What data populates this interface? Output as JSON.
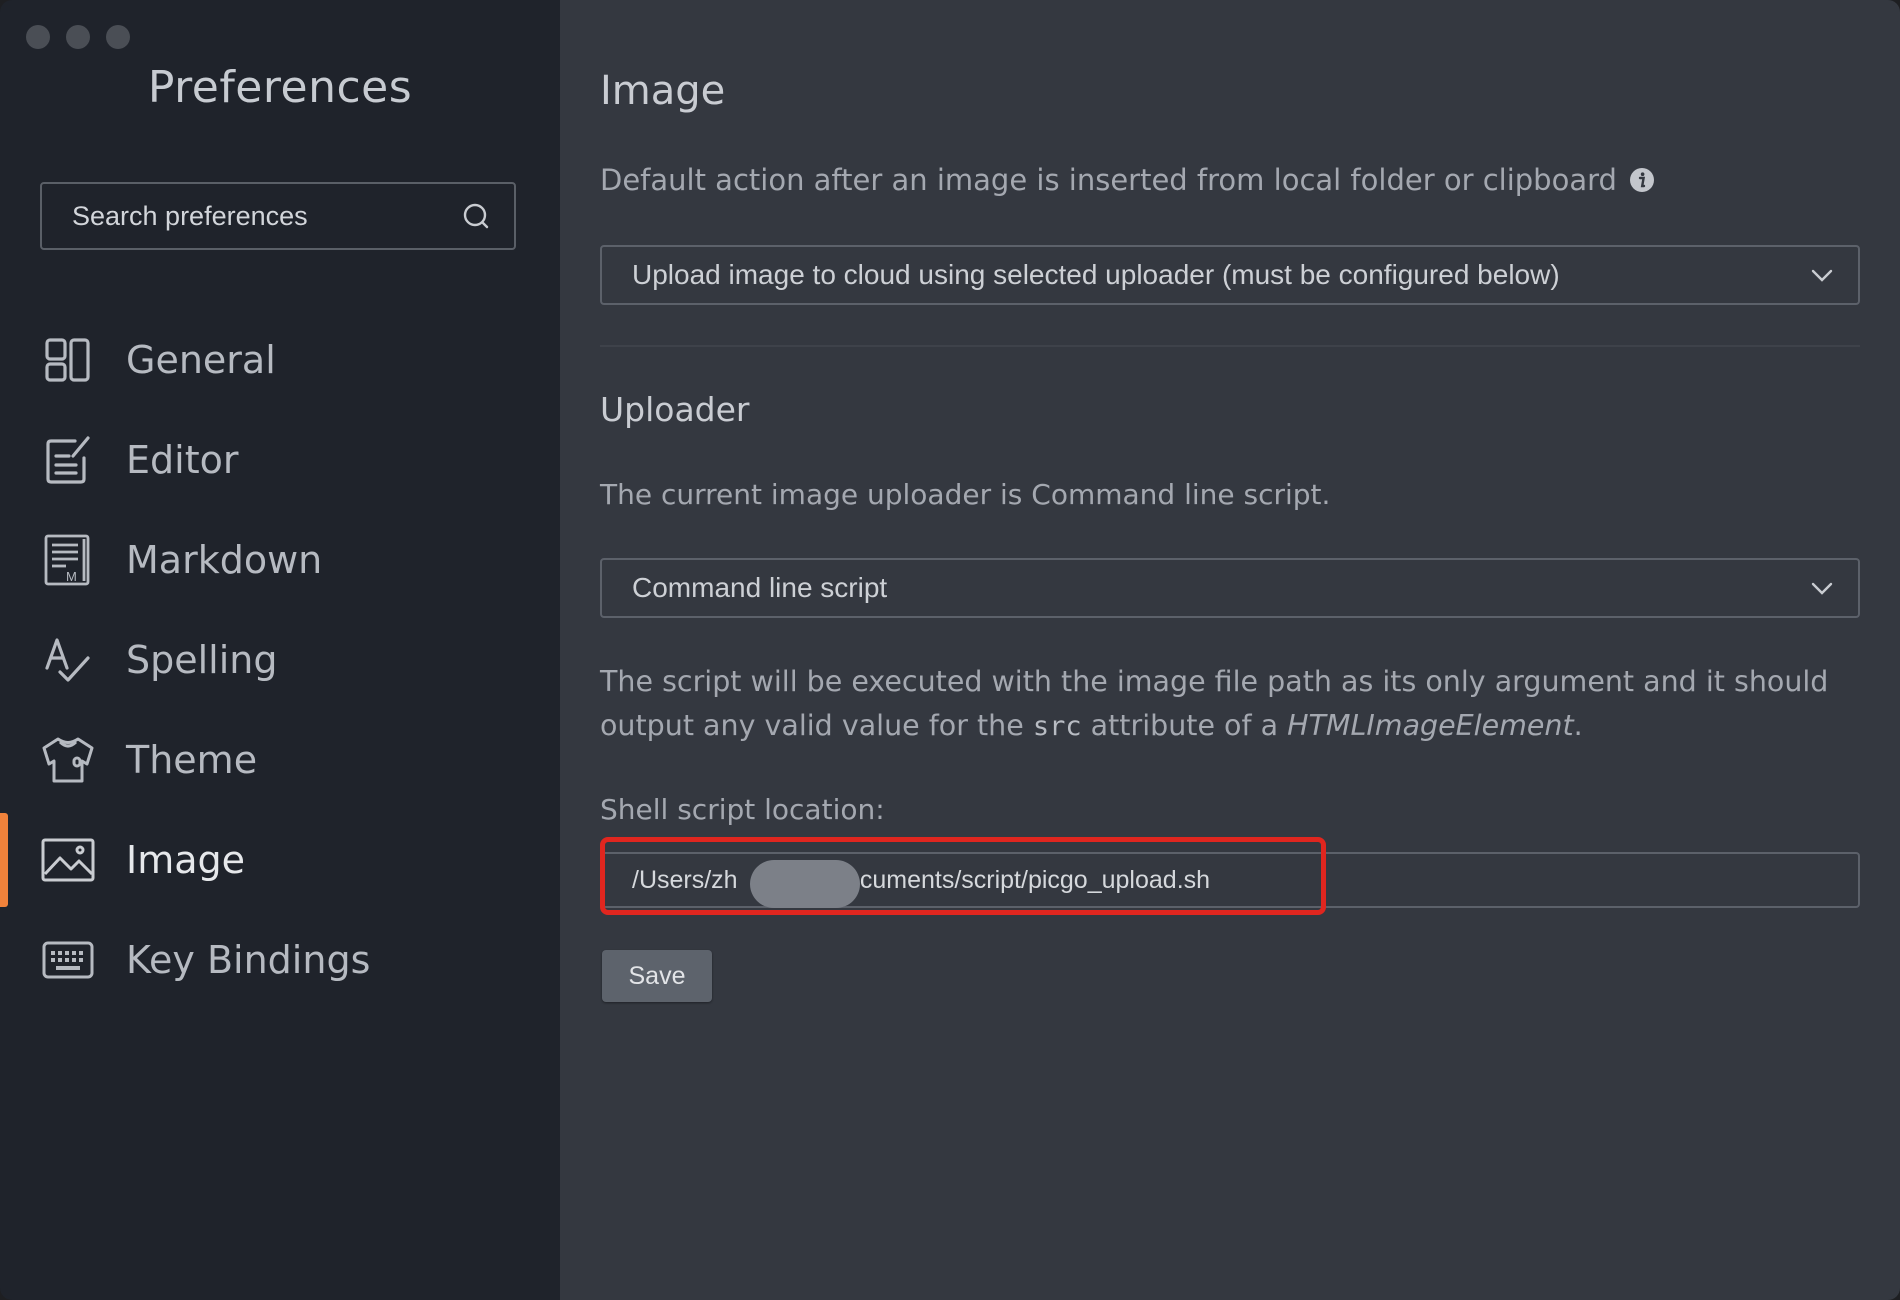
{
  "sidebar": {
    "title": "Preferences",
    "search_placeholder": "Search preferences",
    "items": [
      {
        "id": "general",
        "label": "General",
        "icon": "grid-icon",
        "active": false
      },
      {
        "id": "editor",
        "label": "Editor",
        "icon": "edit-icon",
        "active": false
      },
      {
        "id": "markdown",
        "label": "Markdown",
        "icon": "markdown-icon",
        "active": false
      },
      {
        "id": "spelling",
        "label": "Spelling",
        "icon": "spellcheck-icon",
        "active": false
      },
      {
        "id": "theme",
        "label": "Theme",
        "icon": "shirt-icon",
        "active": false
      },
      {
        "id": "image",
        "label": "Image",
        "icon": "image-icon",
        "active": true
      },
      {
        "id": "keybindings",
        "label": "Key Bindings",
        "icon": "keyboard-icon",
        "active": false
      }
    ]
  },
  "main": {
    "title": "Image",
    "default_action_label": "Default action after an image is inserted from local folder or clipboard",
    "default_action_value": "Upload image to cloud using selected uploader (must be configured below)",
    "uploader_title": "Uploader",
    "uploader_current": "The current image uploader is Command line script.",
    "uploader_value": "Command line script",
    "script_desc_1": "The script will be executed with the image file path as its only argument and it should output any valid value for the ",
    "script_desc_code": "src",
    "script_desc_2": " attribute of a ",
    "script_desc_em": "HTMLImageElement",
    "script_desc_3": ".",
    "shell_label": "Shell script location:",
    "shell_value": "/Users/zh          g/Documents/script/picgo_upload.sh",
    "save_label": "Save"
  },
  "colors": {
    "accent": "#f0823b",
    "highlight": "#e0261f"
  }
}
